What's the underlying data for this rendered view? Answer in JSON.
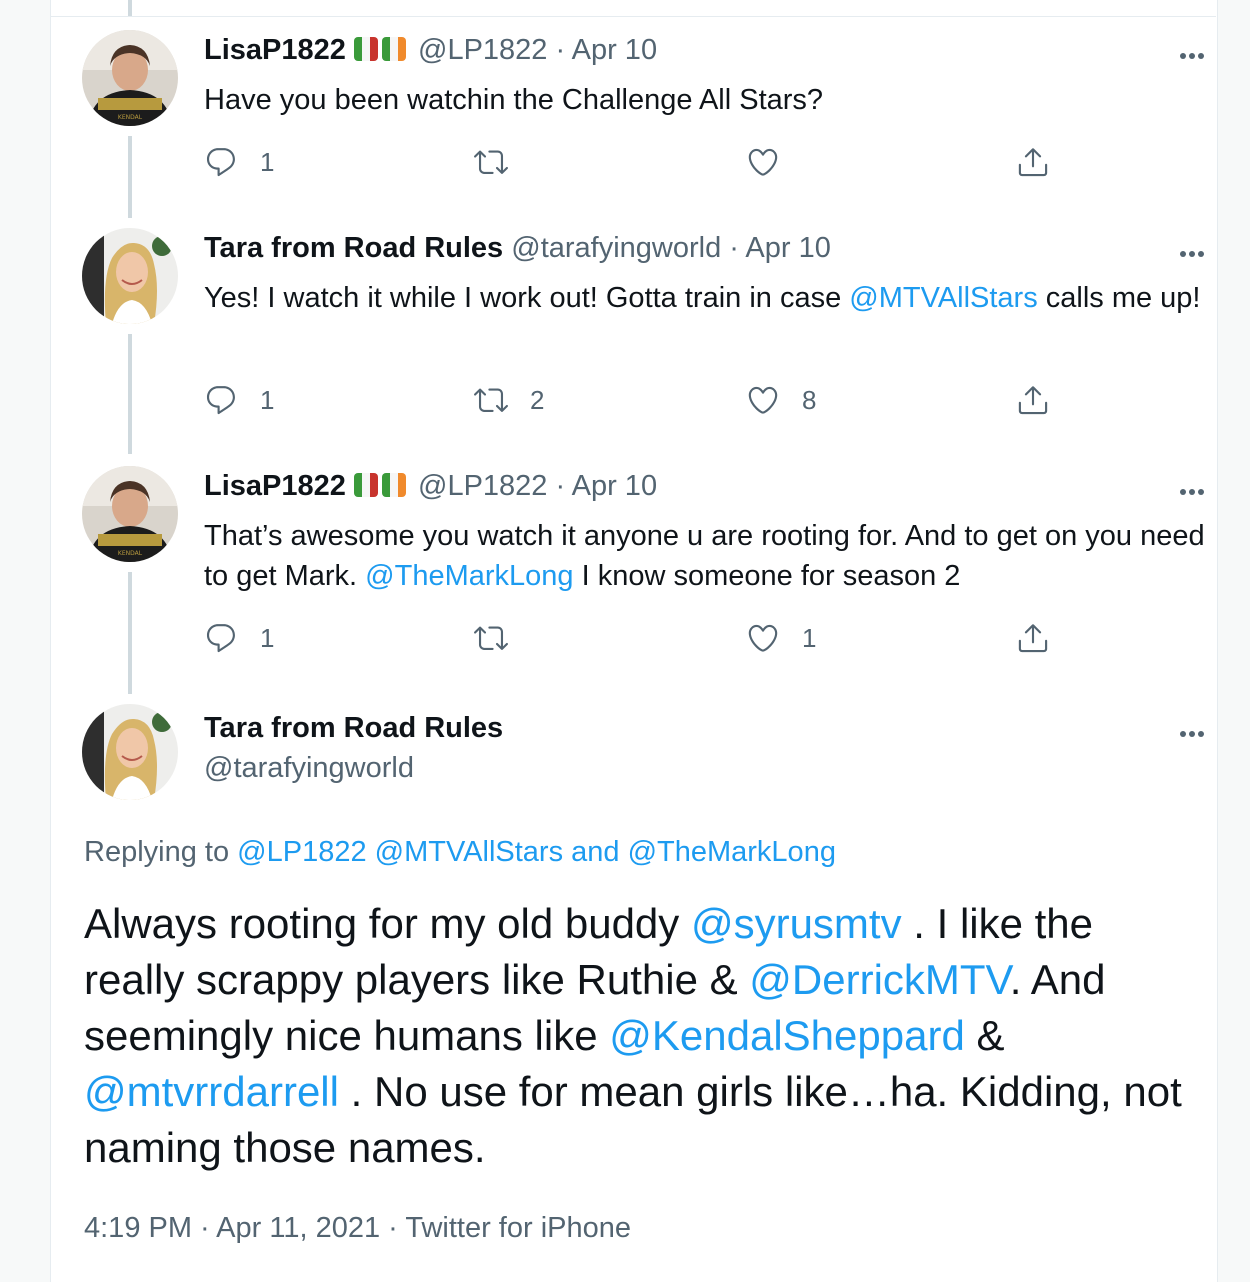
{
  "tweets": [
    {
      "name": "LisaP1822",
      "handle": "@LP1822",
      "sep": " · ",
      "date": "Apr 10",
      "text_parts": [
        "Have you been watchin the Challenge All Stars?"
      ],
      "replies": "1",
      "retweets": "",
      "likes": ""
    },
    {
      "name": "Tara from Road Rules",
      "handle": "@tarafyingworld",
      "sep": " · ",
      "date": "Apr 10",
      "text_parts": [
        "Yes! I watch it while I work out! Gotta train in case ",
        "@MTVAllStars",
        " calls me up!"
      ],
      "replies": "1",
      "retweets": "2",
      "likes": "8"
    },
    {
      "name": "LisaP1822",
      "handle": "@LP1822",
      "sep": " · ",
      "date": "Apr 10",
      "text_parts": [
        "That’s awesome you watch it anyone u are rooting for. And to get on you need to get Mark. ",
        "@TheMarkLong",
        " I know someone for season 2"
      ],
      "replies": "1",
      "retweets": "",
      "likes": "1"
    }
  ],
  "main": {
    "name": "Tara from Road Rules",
    "handle": "@tarafyingworld",
    "replying_prefix": "Replying to ",
    "replying_1": "@LP1822",
    "replying_2": "@MTVAllStars",
    "replying_and": " and ",
    "replying_3": "@TheMarkLong",
    "text_parts": [
      "Always rooting for my old buddy ",
      "@syrusmtv",
      " . I like the really scrappy players like Ruthie & ",
      "@DerrickMTV",
      ". And seemingly nice humans like ",
      "@KendalSheppard",
      " & ",
      "@mtvrrdarrell",
      " . No use for mean girls like…ha. Kidding, not naming those names."
    ],
    "time": "4:19 PM",
    "sep": " · ",
    "date": "Apr 11, 2021",
    "source": "Twitter for iPhone"
  },
  "colors": {
    "link": "#1d9bf0",
    "secondary_text": "#536471",
    "thread_line": "#cfd9de"
  },
  "icons": [
    "reply-icon",
    "retweet-icon",
    "like-icon",
    "share-icon",
    "more-icon",
    "flag-icon"
  ]
}
